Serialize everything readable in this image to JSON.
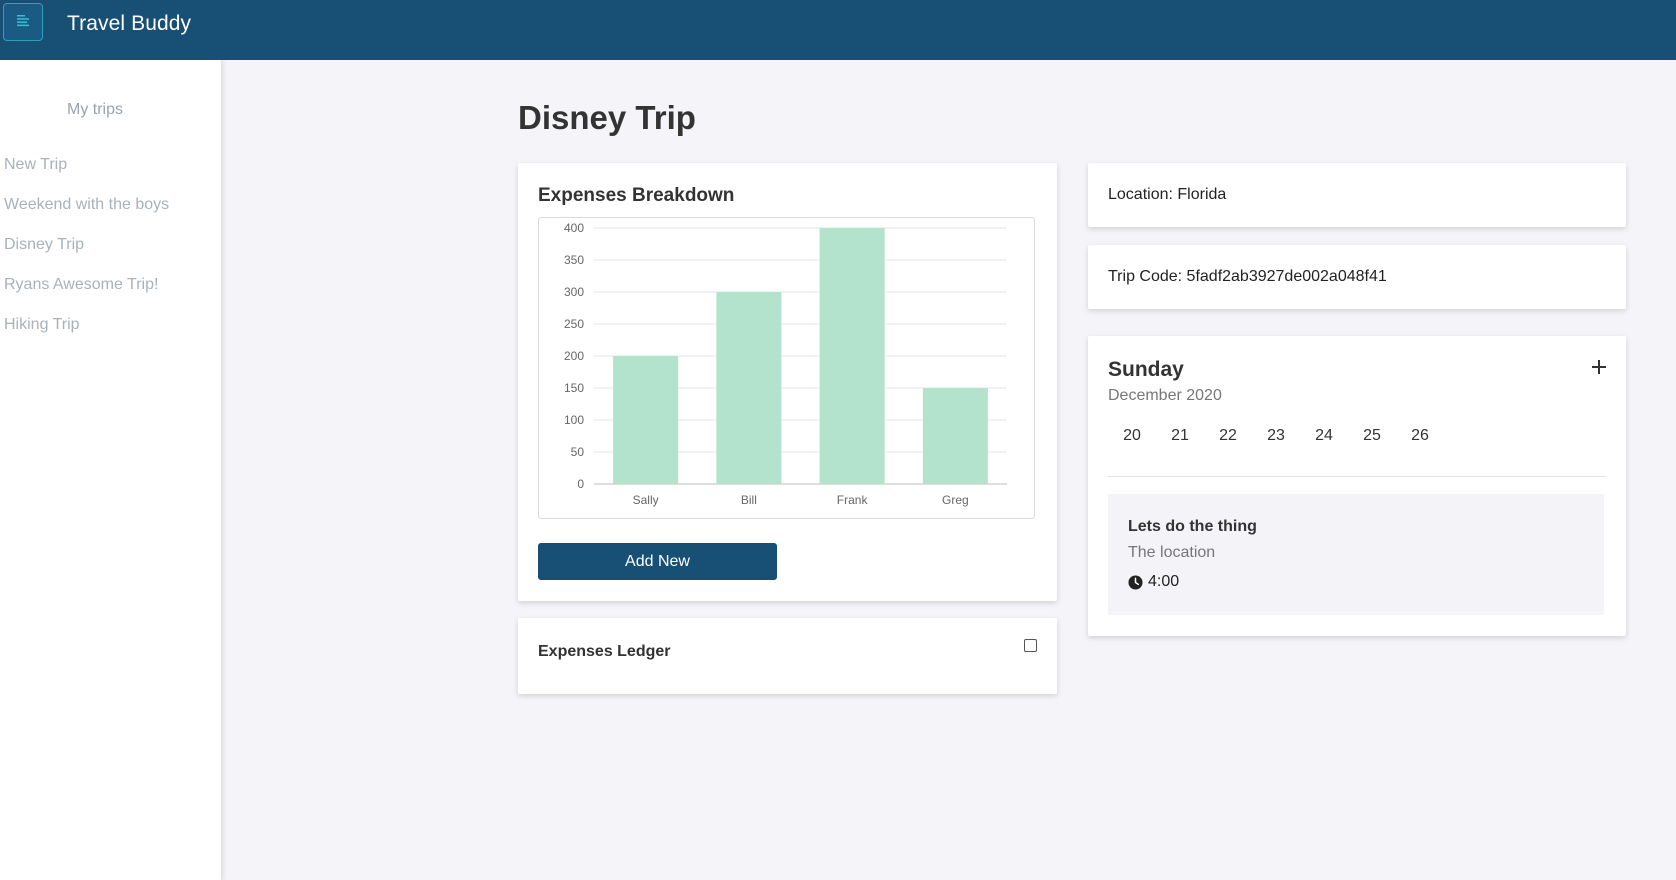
{
  "app": {
    "title": "Travel Buddy"
  },
  "sidebar": {
    "heading": "My trips",
    "items": [
      {
        "label": "New Trip"
      },
      {
        "label": "Weekend with the boys"
      },
      {
        "label": "Disney Trip"
      },
      {
        "label": "Ryans Awesome Trip!"
      },
      {
        "label": "Hiking Trip"
      }
    ]
  },
  "page": {
    "title": "Disney Trip"
  },
  "expenses": {
    "title": "Expenses Breakdown",
    "add_button": "Add New"
  },
  "chart_data": {
    "type": "bar",
    "categories": [
      "Sally",
      "Bill",
      "Frank",
      "Greg"
    ],
    "values": [
      200,
      300,
      400,
      150
    ],
    "ylim": [
      0,
      400
    ],
    "yticks": [
      0,
      50,
      100,
      150,
      200,
      250,
      300,
      350,
      400
    ],
    "bar_color": "#b3e3cd",
    "grid": true
  },
  "location": {
    "text": "Location: Florida"
  },
  "trip_code": {
    "text": "Trip Code: 5fadf2ab3927de002a048f41"
  },
  "calendar": {
    "day_name": "Sunday",
    "month": "December 2020",
    "add_icon": "plus-icon",
    "dates": [
      "20",
      "21",
      "22",
      "23",
      "24",
      "25",
      "26"
    ],
    "event": {
      "title": "Lets do the thing",
      "location": "The location",
      "time": "4:00",
      "time_icon": "clock-icon"
    }
  },
  "ledger": {
    "title": "Expenses Ledger"
  },
  "colors": {
    "primary": "#174f75",
    "bar": "#b3e3cd",
    "background": "#f5f5f9",
    "sidebar_text": "#a9b1b9"
  }
}
